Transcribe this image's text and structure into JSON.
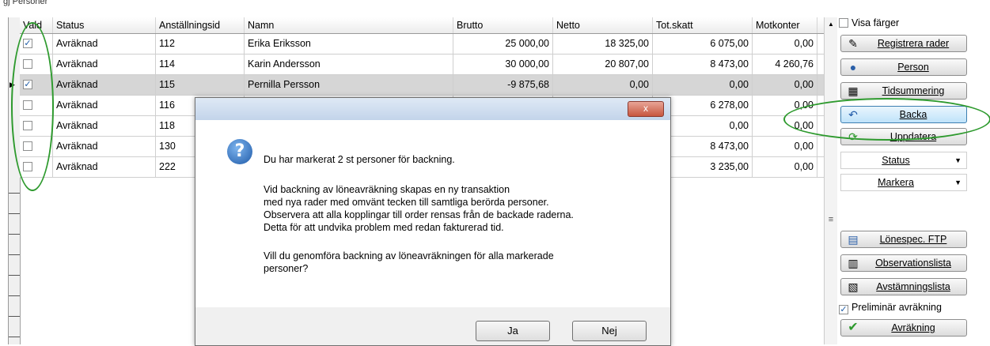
{
  "section_title": "gj Personer",
  "columns": [
    "Vald",
    "Status",
    "Anställningsid",
    "Namn",
    "Brutto",
    "Netto",
    "Tot.skatt",
    "Motkonter"
  ],
  "rows": [
    {
      "checked": true,
      "status": "Avräknad",
      "id": "112",
      "name": "Erika Eriksson",
      "brutto": "25 000,00",
      "netto": "18 325,00",
      "skatt": "6 075,00",
      "mot": "0,00"
    },
    {
      "checked": false,
      "status": "Avräknad",
      "id": "114",
      "name": "Karin Andersson",
      "brutto": "30 000,00",
      "netto": "20 807,00",
      "skatt": "8 473,00",
      "mot": "4 260,76"
    },
    {
      "checked": true,
      "status": "Avräknad",
      "id": "115",
      "name": "Pernilla Persson",
      "brutto": "-9 875,68",
      "netto": "0,00",
      "skatt": "0,00",
      "mot": "0,00",
      "selected": true
    },
    {
      "checked": false,
      "status": "Avräknad",
      "id": "116",
      "name": "",
      "brutto": "",
      "netto": "",
      "skatt": "6 278,00",
      "mot": "0,00"
    },
    {
      "checked": false,
      "status": "Avräknad",
      "id": "118",
      "name": "",
      "brutto": "",
      "netto": "",
      "skatt": "0,00",
      "mot": "0,00"
    },
    {
      "checked": false,
      "status": "Avräknad",
      "id": "130",
      "name": "",
      "brutto": "",
      "netto": "",
      "skatt": "8 473,00",
      "mot": "0,00"
    },
    {
      "checked": false,
      "status": "Avräknad",
      "id": "222",
      "name": "",
      "brutto": "",
      "netto": "",
      "skatt": "3 235,00",
      "mot": "0,00"
    }
  ],
  "panel": {
    "visa_farger": {
      "label": "Visa färger",
      "checked": false
    },
    "buttons": [
      {
        "label": "Registrera rader",
        "icon": "pencil-icon"
      },
      {
        "label": "Person",
        "icon": "person-icon"
      },
      {
        "label": "Tidsummering",
        "icon": "calculator-icon"
      },
      {
        "label": "Backa",
        "icon": "undo-arrow-icon"
      },
      {
        "label": "Uppdatera",
        "icon": "refresh-icon"
      }
    ],
    "status_dropdown": "Status",
    "markera_dropdown": "Markera",
    "lower_buttons": [
      {
        "label": "Lönespec. FTP",
        "icon": "payslip-icon"
      },
      {
        "label": "Observationslista",
        "icon": "list-icon"
      },
      {
        "label": "Avstämningslista",
        "icon": "reconcile-icon"
      }
    ],
    "preliminar": {
      "label": "Preliminär avräkning",
      "checked": true
    },
    "avrakning_button": {
      "label": "Avräkning",
      "icon": "checkmark-icon"
    }
  },
  "dialog": {
    "close_symbol": "x",
    "lines": [
      "Du har markerat 2 st personer för backning.",
      "Vid backning av löneavräkning skapas en ny transaktion",
      "med nya rader med omvänt tecken till samtliga berörda personer.",
      "Observera att alla kopplingar till order rensas från de backade raderna.",
      "Detta för att undvika problem med redan fakturerad tid.",
      "Vill du genomföra backning av löneavräkningen för alla markerade",
      "personer?"
    ],
    "yes_label": "Ja",
    "no_label": "Nej"
  },
  "colors": {
    "highlight_oval": "#2e9a2e",
    "selected_row": "#d6d6d6",
    "accent": "#1f5aa8"
  }
}
